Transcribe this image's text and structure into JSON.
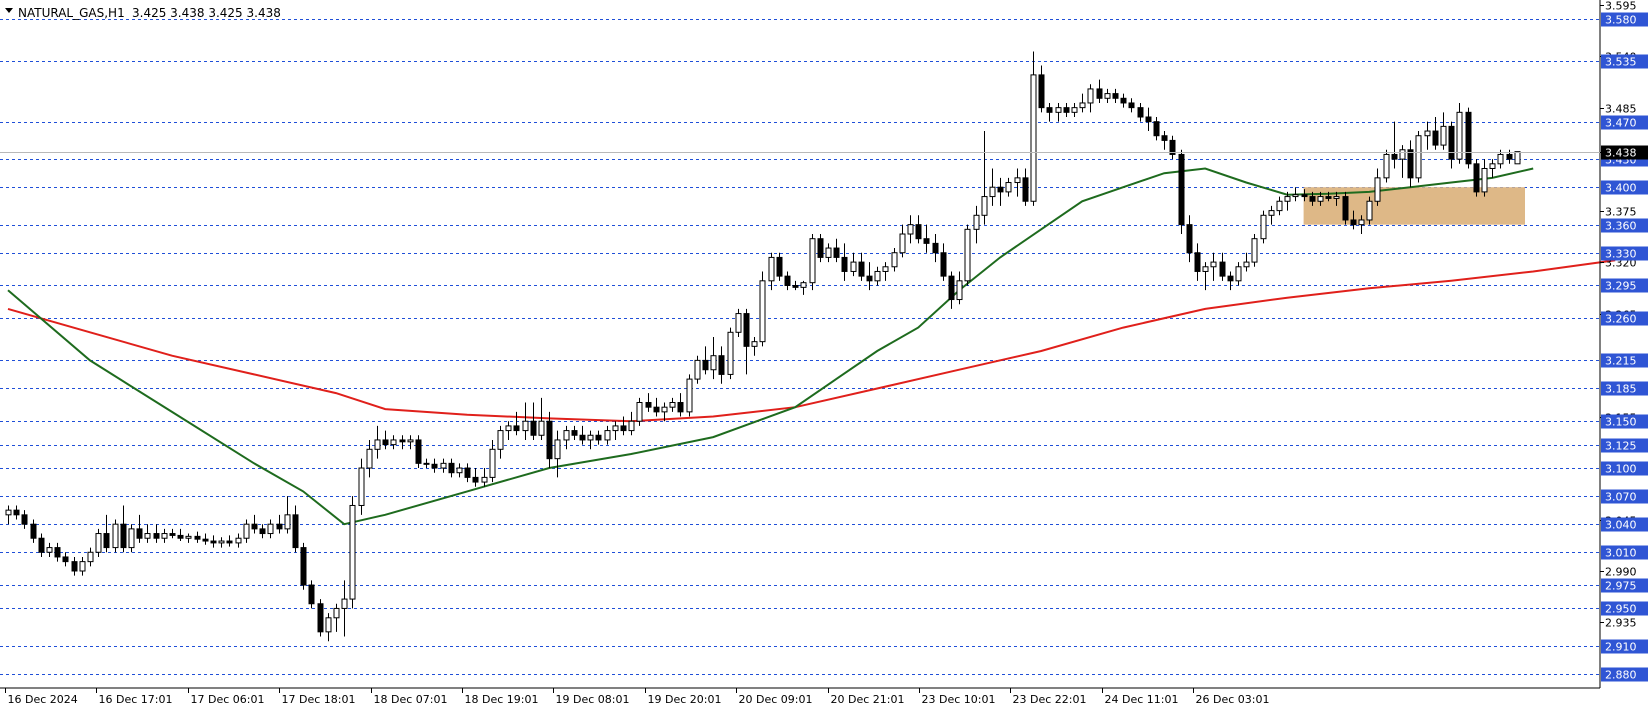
{
  "header": {
    "symbol": "NATURAL_GAS,H1",
    "ohlc": "3.425 3.438 3.425 3.438"
  },
  "colors": {
    "level_line": "#1f4fd8",
    "level_label_bg": "#2f55d4",
    "ma_fast": "#1e6b1e",
    "ma_slow": "#e0201b",
    "zone": "#deb887",
    "current_price_bg": "#000000"
  },
  "chart_data": {
    "type": "candlestick",
    "ylim": [
      2.865,
      3.6
    ],
    "grid": false,
    "y_ticks": [
      "3.595",
      "3.540",
      "3.485",
      "3.438",
      "3.375",
      "3.320",
      "3.265",
      "3.155",
      "3.045",
      "2.990",
      "2.935"
    ],
    "level_labels": [
      "3.580",
      "3.535",
      "3.470",
      "3.430",
      "3.400",
      "3.360",
      "3.330",
      "3.295",
      "3.260",
      "3.215",
      "3.185",
      "3.150",
      "3.125",
      "3.100",
      "3.070",
      "3.040",
      "3.010",
      "2.975",
      "2.950",
      "2.910",
      "2.880"
    ],
    "current_price": "3.438",
    "x_labels": [
      "16 Dec 2024",
      "16 Dec 17:01",
      "17 Dec 06:01",
      "17 Dec 18:01",
      "18 Dec 07:01",
      "18 Dec 19:01",
      "19 Dec 08:01",
      "19 Dec 20:01",
      "20 Dec 09:01",
      "20 Dec 21:01",
      "23 Dec 10:01",
      "23 Dec 22:01",
      "24 Dec 11:01",
      "26 Dec 03:01"
    ],
    "zone": {
      "from_index": 158,
      "to_index": 185,
      "low": 3.36,
      "high": 3.4
    },
    "candles": [
      [
        3.05,
        3.06,
        3.04,
        3.055
      ],
      [
        3.055,
        3.06,
        3.045,
        3.05
      ],
      [
        3.05,
        3.055,
        3.035,
        3.04
      ],
      [
        3.04,
        3.045,
        3.02,
        3.025
      ],
      [
        3.025,
        3.03,
        3.005,
        3.01
      ],
      [
        3.01,
        3.02,
        3.005,
        3.015
      ],
      [
        3.015,
        3.02,
        3.0,
        3.005
      ],
      [
        3.005,
        3.01,
        2.995,
        3.0
      ],
      [
        3.0,
        3.005,
        2.985,
        2.99
      ],
      [
        2.99,
        3.005,
        2.985,
        3.0
      ],
      [
        3.0,
        3.015,
        2.995,
        3.01
      ],
      [
        3.01,
        3.035,
        3.005,
        3.03
      ],
      [
        3.03,
        3.05,
        3.01,
        3.015
      ],
      [
        3.015,
        3.045,
        3.01,
        3.04
      ],
      [
        3.04,
        3.06,
        3.01,
        3.015
      ],
      [
        3.015,
        3.04,
        3.01,
        3.035
      ],
      [
        3.035,
        3.05,
        3.02,
        3.025
      ],
      [
        3.025,
        3.04,
        3.02,
        3.03
      ],
      [
        3.03,
        3.04,
        3.02,
        3.025
      ],
      [
        3.025,
        3.035,
        3.02,
        3.03
      ],
      [
        3.03,
        3.035,
        3.025,
        3.028
      ],
      [
        3.028,
        3.035,
        3.022,
        3.025
      ],
      [
        3.025,
        3.03,
        3.02,
        3.027
      ],
      [
        3.027,
        3.032,
        3.02,
        3.024
      ],
      [
        3.024,
        3.03,
        3.018,
        3.022
      ],
      [
        3.022,
        3.028,
        3.015,
        3.02
      ],
      [
        3.02,
        3.026,
        3.015,
        3.022
      ],
      [
        3.022,
        3.028,
        3.016,
        3.02
      ],
      [
        3.02,
        3.03,
        3.015,
        3.025
      ],
      [
        3.025,
        3.045,
        3.02,
        3.04
      ],
      [
        3.04,
        3.05,
        3.03,
        3.035
      ],
      [
        3.035,
        3.04,
        3.025,
        3.03
      ],
      [
        3.03,
        3.045,
        3.025,
        3.04
      ],
      [
        3.04,
        3.05,
        3.03,
        3.035
      ],
      [
        3.035,
        3.07,
        3.03,
        3.05
      ],
      [
        3.05,
        3.06,
        3.01,
        3.015
      ],
      [
        3.015,
        3.02,
        2.97,
        2.975
      ],
      [
        2.975,
        2.98,
        2.95,
        2.955
      ],
      [
        2.955,
        2.96,
        2.92,
        2.925
      ],
      [
        2.925,
        2.945,
        2.915,
        2.94
      ],
      [
        2.94,
        2.955,
        2.925,
        2.95
      ],
      [
        2.95,
        2.98,
        2.92,
        2.96
      ],
      [
        2.96,
        3.07,
        2.95,
        3.06
      ],
      [
        3.06,
        3.11,
        3.05,
        3.1
      ],
      [
        3.1,
        3.13,
        3.09,
        3.12
      ],
      [
        3.12,
        3.145,
        3.11,
        3.13
      ],
      [
        3.13,
        3.14,
        3.12,
        3.125
      ],
      [
        3.125,
        3.135,
        3.12,
        3.13
      ],
      [
        3.13,
        3.135,
        3.12,
        3.128
      ],
      [
        3.128,
        3.135,
        3.12,
        3.13
      ],
      [
        3.13,
        3.135,
        3.1,
        3.105
      ],
      [
        3.105,
        3.11,
        3.1,
        3.104
      ],
      [
        3.104,
        3.11,
        3.095,
        3.1
      ],
      [
        3.1,
        3.11,
        3.095,
        3.105
      ],
      [
        3.105,
        3.11,
        3.09,
        3.095
      ],
      [
        3.095,
        3.105,
        3.09,
        3.1
      ],
      [
        3.1,
        3.105,
        3.085,
        3.09
      ],
      [
        3.09,
        3.1,
        3.08,
        3.085
      ],
      [
        3.085,
        3.1,
        3.08,
        3.09
      ],
      [
        3.09,
        3.13,
        3.085,
        3.12
      ],
      [
        3.12,
        3.145,
        3.11,
        3.14
      ],
      [
        3.14,
        3.15,
        3.13,
        3.145
      ],
      [
        3.145,
        3.16,
        3.135,
        3.14
      ],
      [
        3.14,
        3.17,
        3.13,
        3.15
      ],
      [
        3.15,
        3.17,
        3.13,
        3.135
      ],
      [
        3.135,
        3.175,
        3.13,
        3.15
      ],
      [
        3.15,
        3.16,
        3.1,
        3.11
      ],
      [
        3.11,
        3.14,
        3.09,
        3.13
      ],
      [
        3.13,
        3.145,
        3.12,
        3.14
      ],
      [
        3.14,
        3.145,
        3.13,
        3.135
      ],
      [
        3.135,
        3.145,
        3.125,
        3.13
      ],
      [
        3.13,
        3.14,
        3.12,
        3.135
      ],
      [
        3.135,
        3.14,
        3.125,
        3.13
      ],
      [
        3.13,
        3.145,
        3.125,
        3.14
      ],
      [
        3.14,
        3.15,
        3.13,
        3.145
      ],
      [
        3.145,
        3.155,
        3.135,
        3.14
      ],
      [
        3.14,
        3.16,
        3.135,
        3.15
      ],
      [
        3.15,
        3.175,
        3.145,
        3.17
      ],
      [
        3.17,
        3.18,
        3.16,
        3.165
      ],
      [
        3.165,
        3.175,
        3.155,
        3.16
      ],
      [
        3.16,
        3.17,
        3.15,
        3.165
      ],
      [
        3.165,
        3.175,
        3.16,
        3.17
      ],
      [
        3.17,
        3.18,
        3.155,
        3.16
      ],
      [
        3.16,
        3.2,
        3.155,
        3.195
      ],
      [
        3.195,
        3.22,
        3.19,
        3.215
      ],
      [
        3.215,
        3.23,
        3.2,
        3.205
      ],
      [
        3.205,
        3.24,
        3.195,
        3.22
      ],
      [
        3.22,
        3.23,
        3.19,
        3.2
      ],
      [
        3.2,
        3.25,
        3.195,
        3.245
      ],
      [
        3.245,
        3.27,
        3.24,
        3.265
      ],
      [
        3.265,
        3.27,
        3.2,
        3.23
      ],
      [
        3.23,
        3.24,
        3.22,
        3.235
      ],
      [
        3.235,
        3.31,
        3.23,
        3.3
      ],
      [
        3.3,
        3.33,
        3.29,
        3.325
      ],
      [
        3.325,
        3.33,
        3.3,
        3.305
      ],
      [
        3.305,
        3.31,
        3.29,
        3.295
      ],
      [
        3.295,
        3.3,
        3.29,
        3.293
      ],
      [
        3.293,
        3.3,
        3.285,
        3.298
      ],
      [
        3.298,
        3.35,
        3.29,
        3.345
      ],
      [
        3.345,
        3.35,
        3.32,
        3.325
      ],
      [
        3.325,
        3.34,
        3.32,
        3.335
      ],
      [
        3.335,
        3.345,
        3.32,
        3.325
      ],
      [
        3.325,
        3.34,
        3.3,
        3.31
      ],
      [
        3.31,
        3.33,
        3.305,
        3.32
      ],
      [
        3.32,
        3.33,
        3.3,
        3.305
      ],
      [
        3.305,
        3.32,
        3.29,
        3.3
      ],
      [
        3.3,
        3.315,
        3.295,
        3.31
      ],
      [
        3.31,
        3.32,
        3.3,
        3.315
      ],
      [
        3.315,
        3.335,
        3.31,
        3.33
      ],
      [
        3.33,
        3.36,
        3.325,
        3.35
      ],
      [
        3.35,
        3.37,
        3.34,
        3.36
      ],
      [
        3.36,
        3.37,
        3.34,
        3.345
      ],
      [
        3.345,
        3.36,
        3.33,
        3.34
      ],
      [
        3.34,
        3.35,
        3.32,
        3.33
      ],
      [
        3.33,
        3.34,
        3.3,
        3.305
      ],
      [
        3.305,
        3.31,
        3.27,
        3.28
      ],
      [
        3.28,
        3.31,
        3.275,
        3.3
      ],
      [
        3.3,
        3.36,
        3.295,
        3.355
      ],
      [
        3.355,
        3.38,
        3.34,
        3.37
      ],
      [
        3.37,
        3.46,
        3.36,
        3.39
      ],
      [
        3.39,
        3.42,
        3.38,
        3.4
      ],
      [
        3.4,
        3.41,
        3.38,
        3.395
      ],
      [
        3.395,
        3.41,
        3.39,
        3.405
      ],
      [
        3.405,
        3.42,
        3.39,
        3.41
      ],
      [
        3.41,
        3.42,
        3.38,
        3.385
      ],
      [
        3.385,
        3.545,
        3.38,
        3.52
      ],
      [
        3.52,
        3.53,
        3.48,
        3.485
      ],
      [
        3.485,
        3.49,
        3.47,
        3.48
      ],
      [
        3.48,
        3.49,
        3.47,
        3.485
      ],
      [
        3.485,
        3.49,
        3.475,
        3.48
      ],
      [
        3.48,
        3.49,
        3.475,
        3.485
      ],
      [
        3.485,
        3.5,
        3.48,
        3.49
      ],
      [
        3.49,
        3.51,
        3.48,
        3.505
      ],
      [
        3.505,
        3.515,
        3.49,
        3.495
      ],
      [
        3.495,
        3.505,
        3.49,
        3.5
      ],
      [
        3.5,
        3.505,
        3.49,
        3.495
      ],
      [
        3.495,
        3.5,
        3.485,
        3.49
      ],
      [
        3.49,
        3.495,
        3.48,
        3.485
      ],
      [
        3.485,
        3.49,
        3.47,
        3.475
      ],
      [
        3.475,
        3.485,
        3.46,
        3.47
      ],
      [
        3.47,
        3.475,
        3.45,
        3.455
      ],
      [
        3.455,
        3.46,
        3.44,
        3.45
      ],
      [
        3.45,
        3.455,
        3.43,
        3.435
      ],
      [
        3.435,
        3.44,
        3.35,
        3.36
      ],
      [
        3.36,
        3.37,
        3.32,
        3.33
      ],
      [
        3.33,
        3.34,
        3.3,
        3.31
      ],
      [
        3.31,
        3.32,
        3.29,
        3.315
      ],
      [
        3.315,
        3.33,
        3.3,
        3.32
      ],
      [
        3.32,
        3.33,
        3.3,
        3.305
      ],
      [
        3.305,
        3.31,
        3.29,
        3.3
      ],
      [
        3.3,
        3.32,
        3.295,
        3.315
      ],
      [
        3.315,
        3.33,
        3.31,
        3.32
      ],
      [
        3.32,
        3.35,
        3.315,
        3.345
      ],
      [
        3.345,
        3.375,
        3.34,
        3.37
      ],
      [
        3.37,
        3.38,
        3.36,
        3.375
      ],
      [
        3.375,
        3.39,
        3.37,
        3.385
      ],
      [
        3.385,
        3.395,
        3.375,
        3.39
      ],
      [
        3.39,
        3.4,
        3.385,
        3.392
      ],
      [
        3.392,
        3.398,
        3.385,
        3.39
      ],
      [
        3.39,
        3.395,
        3.38,
        3.385
      ],
      [
        3.385,
        3.395,
        3.38,
        3.39
      ],
      [
        3.39,
        3.395,
        3.385,
        3.388
      ],
      [
        3.388,
        3.395,
        3.38,
        3.39
      ],
      [
        3.39,
        3.395,
        3.36,
        3.365
      ],
      [
        3.365,
        3.375,
        3.355,
        3.36
      ],
      [
        3.36,
        3.37,
        3.35,
        3.365
      ],
      [
        3.365,
        3.39,
        3.36,
        3.385
      ],
      [
        3.385,
        3.42,
        3.38,
        3.41
      ],
      [
        3.41,
        3.44,
        3.405,
        3.435
      ],
      [
        3.435,
        3.47,
        3.42,
        3.43
      ],
      [
        3.43,
        3.445,
        3.41,
        3.44
      ],
      [
        3.44,
        3.45,
        3.4,
        3.41
      ],
      [
        3.41,
        3.46,
        3.405,
        3.455
      ],
      [
        3.455,
        3.47,
        3.44,
        3.46
      ],
      [
        3.46,
        3.475,
        3.44,
        3.445
      ],
      [
        3.445,
        3.48,
        3.44,
        3.465
      ],
      [
        3.465,
        3.47,
        3.42,
        3.43
      ],
      [
        3.43,
        3.49,
        3.425,
        3.48
      ],
      [
        3.48,
        3.485,
        3.42,
        3.425
      ],
      [
        3.425,
        3.43,
        3.39,
        3.395
      ],
      [
        3.395,
        3.43,
        3.39,
        3.42
      ],
      [
        3.42,
        3.43,
        3.41,
        3.425
      ],
      [
        3.425,
        3.44,
        3.42,
        3.435
      ],
      [
        3.435,
        3.44,
        3.425,
        3.43
      ],
      [
        3.425,
        3.438,
        3.425,
        3.438
      ]
    ],
    "ma_fast": [
      [
        0,
        3.29
      ],
      [
        10,
        3.215
      ],
      [
        20,
        3.16
      ],
      [
        30,
        3.105
      ],
      [
        36,
        3.075
      ],
      [
        41,
        3.04
      ],
      [
        46,
        3.05
      ],
      [
        56,
        3.075
      ],
      [
        66,
        3.1
      ],
      [
        76,
        3.115
      ],
      [
        86,
        3.133
      ],
      [
        96,
        3.165
      ],
      [
        101,
        3.195
      ],
      [
        106,
        3.225
      ],
      [
        111,
        3.25
      ],
      [
        116,
        3.29
      ],
      [
        121,
        3.325
      ],
      [
        126,
        3.355
      ],
      [
        131,
        3.385
      ],
      [
        136,
        3.4
      ],
      [
        141,
        3.415
      ],
      [
        146,
        3.42
      ],
      [
        151,
        3.405
      ],
      [
        156,
        3.392
      ],
      [
        161,
        3.393
      ],
      [
        166,
        3.395
      ],
      [
        171,
        3.4
      ],
      [
        176,
        3.405
      ],
      [
        181,
        3.41
      ],
      [
        186,
        3.42
      ]
    ],
    "ma_slow": [
      [
        0,
        3.27
      ],
      [
        10,
        3.245
      ],
      [
        20,
        3.22
      ],
      [
        30,
        3.2
      ],
      [
        40,
        3.18
      ],
      [
        46,
        3.163
      ],
      [
        56,
        3.157
      ],
      [
        66,
        3.153
      ],
      [
        76,
        3.15
      ],
      [
        86,
        3.155
      ],
      [
        96,
        3.165
      ],
      [
        106,
        3.185
      ],
      [
        116,
        3.205
      ],
      [
        126,
        3.225
      ],
      [
        136,
        3.25
      ],
      [
        146,
        3.27
      ],
      [
        156,
        3.282
      ],
      [
        166,
        3.292
      ],
      [
        176,
        3.3
      ],
      [
        186,
        3.31
      ],
      [
        196,
        3.322
      ]
    ]
  }
}
